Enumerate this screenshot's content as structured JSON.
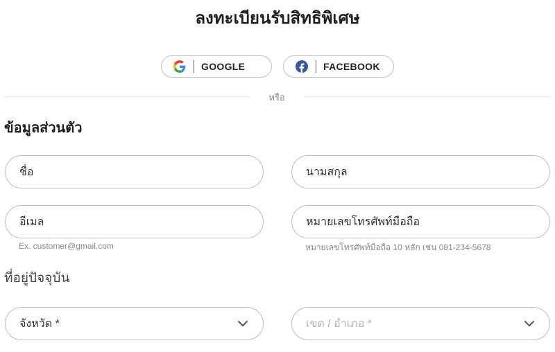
{
  "page": {
    "title": "ลงทะเบียนรับสิทธิพิเศษ"
  },
  "social": {
    "google_label": "GOOGLE",
    "facebook_label": "FACEBOOK",
    "divider_text": "หรือ"
  },
  "personal": {
    "section_title": "ข้อมูลส่วนตัว",
    "first_name_placeholder": "ชื่อ",
    "last_name_placeholder": "นามสกุล",
    "email_placeholder": "อีเมล",
    "phone_placeholder": "หมายเลขโทรศัพท์มือถือ",
    "email_hint": "Ex. customer@gmail.com",
    "phone_hint": "หมายเลขโทรศัพท์มือถือ 10 หลัก เช่น 081-234-5678"
  },
  "address": {
    "section_title": "ที่อยู่ปัจจุบัน",
    "province_label": "จังหวัด *",
    "district_label": "เขต / อำเภอ *"
  },
  "icons": {
    "google": "google-icon",
    "facebook": "facebook-icon",
    "chevron": "chevron-down-icon"
  },
  "colors": {
    "facebook_blue": "#3b5998",
    "border": "#bdbdbd",
    "hint_text": "#888888"
  }
}
